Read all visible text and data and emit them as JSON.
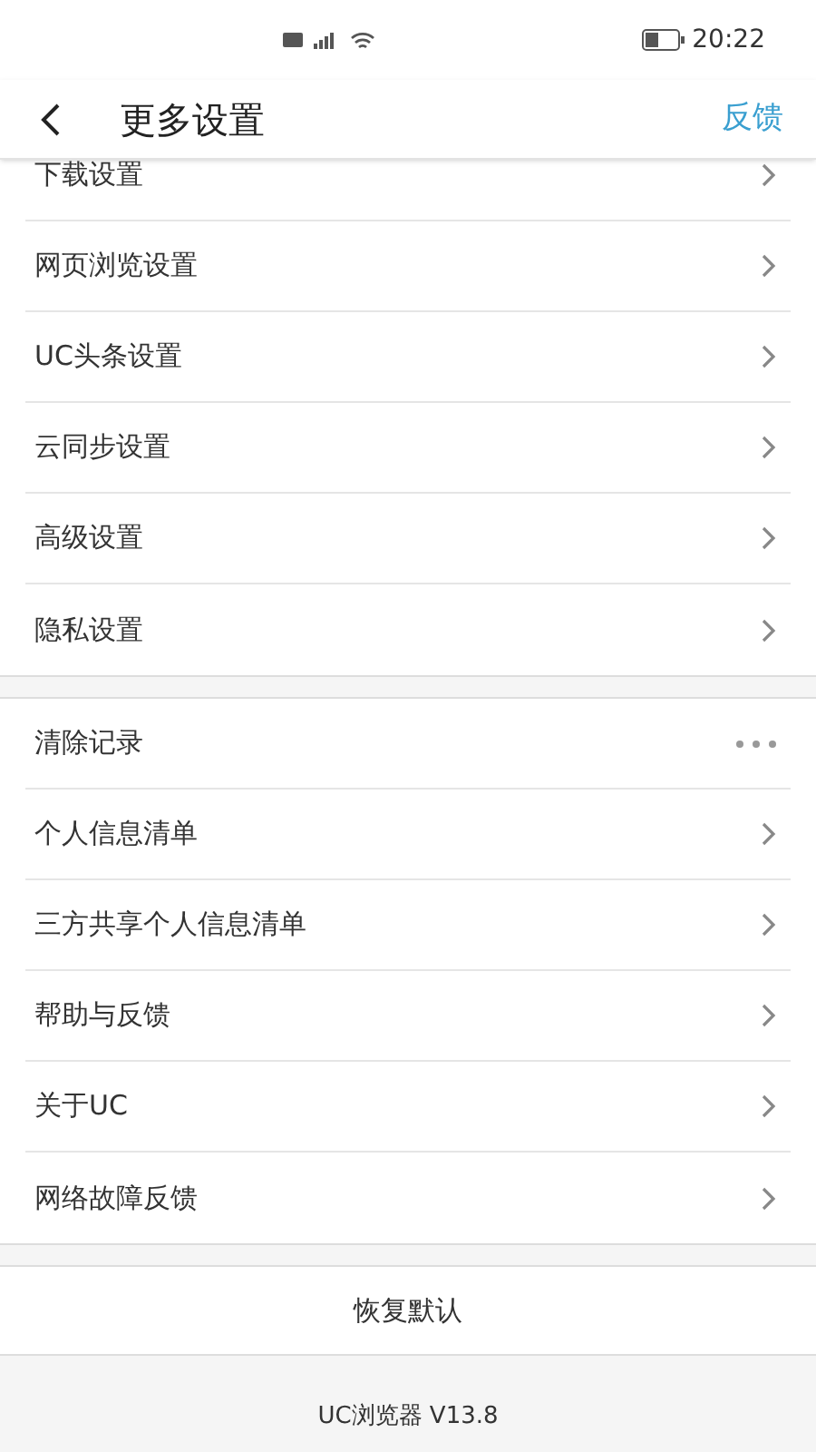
{
  "status_bar": {
    "time": "20:22"
  },
  "header": {
    "title": "更多设置",
    "action": "反馈"
  },
  "groups": [
    {
      "items": [
        {
          "label": "下载设置",
          "kind": "chevron"
        },
        {
          "label": "网页浏览设置",
          "kind": "chevron"
        },
        {
          "label": "UC头条设置",
          "kind": "chevron"
        },
        {
          "label": "云同步设置",
          "kind": "chevron"
        },
        {
          "label": "高级设置",
          "kind": "chevron"
        },
        {
          "label": "隐私设置",
          "kind": "chevron"
        }
      ]
    },
    {
      "items": [
        {
          "label": "清除记录",
          "kind": "more"
        },
        {
          "label": "个人信息清单",
          "kind": "chevron"
        },
        {
          "label": "三方共享个人信息清单",
          "kind": "chevron"
        },
        {
          "label": "帮助与反馈",
          "kind": "chevron"
        },
        {
          "label": "关于UC",
          "kind": "chevron"
        },
        {
          "label": "网络故障反馈",
          "kind": "chevron"
        }
      ]
    }
  ],
  "restore_button": "恢复默认",
  "version": "UC浏览器 V13.8"
}
